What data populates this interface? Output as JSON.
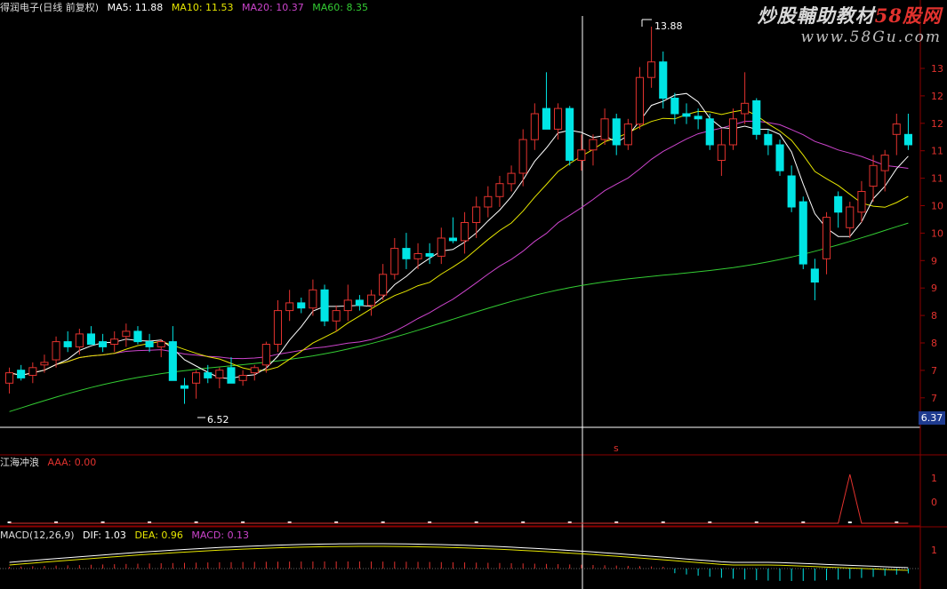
{
  "watermark": {
    "line1_main": "炒股輔助教材",
    "line1_accent": "58股网",
    "line2": "www.58Gu.com"
  },
  "main_panel": {
    "stock_title": "得润电子(日线 前复权)",
    "ma5": "MA5: 11.88",
    "ma10": "MA10: 11.53",
    "ma20": "MA20: 10.37",
    "ma60": "MA60: 8.35",
    "high_label": "13.88",
    "low_label": "6.52",
    "price_box": "6.37",
    "axis_ticks": [
      "13",
      "12",
      "12",
      "11",
      "11",
      "10",
      "10",
      "9",
      "9",
      "8",
      "8",
      "7",
      "7"
    ],
    "marker": "s"
  },
  "indicator_panel": {
    "name": "江海冲浪",
    "value": "AAA: 0.00",
    "axis_ticks": [
      "1",
      "0"
    ]
  },
  "macd_panel": {
    "name": "MACD(12,26,9)",
    "dif": "DIF: 1.03",
    "dea": "DEA: 0.96",
    "macd": "MACD: 0.13",
    "axis_ticks": [
      "1"
    ]
  },
  "colors": {
    "up": "#e2322e",
    "down": "#00e5e5",
    "ma5": "#ffffff",
    "ma10": "#e6e600",
    "ma20": "#cc44cc",
    "ma60": "#33cc33",
    "grid": "#8b0000"
  },
  "chart_data": {
    "type": "candlestick",
    "ohlc": [
      [
        7.0,
        7.3,
        6.8,
        7.2
      ],
      [
        7.25,
        7.35,
        7.05,
        7.1
      ],
      [
        7.15,
        7.4,
        7.0,
        7.3
      ],
      [
        7.35,
        7.55,
        7.2,
        7.4
      ],
      [
        7.45,
        7.9,
        7.3,
        7.8
      ],
      [
        7.8,
        8.0,
        7.6,
        7.7
      ],
      [
        7.7,
        8.05,
        7.55,
        7.95
      ],
      [
        7.95,
        8.1,
        7.8,
        7.75
      ],
      [
        7.8,
        7.95,
        7.6,
        7.7
      ],
      [
        7.75,
        8.0,
        7.6,
        7.85
      ],
      [
        7.9,
        8.15,
        7.7,
        8.0
      ],
      [
        8.0,
        8.1,
        7.75,
        7.8
      ],
      [
        7.8,
        7.95,
        7.6,
        7.7
      ],
      [
        7.7,
        7.85,
        7.5,
        7.8
      ],
      [
        7.8,
        8.1,
        7.2,
        7.05
      ],
      [
        6.95,
        7.1,
        6.6,
        6.9
      ],
      [
        7.0,
        7.25,
        6.7,
        7.2
      ],
      [
        7.2,
        7.35,
        7.0,
        7.1
      ],
      [
        7.1,
        7.3,
        6.9,
        7.25
      ],
      [
        7.3,
        7.5,
        7.1,
        7.0
      ],
      [
        7.05,
        7.25,
        6.95,
        7.15
      ],
      [
        7.2,
        7.35,
        7.05,
        7.3
      ],
      [
        7.35,
        7.8,
        7.2,
        7.75
      ],
      [
        7.75,
        8.6,
        7.6,
        8.4
      ],
      [
        8.4,
        8.8,
        8.2,
        8.55
      ],
      [
        8.55,
        8.65,
        8.35,
        8.45
      ],
      [
        8.45,
        9.0,
        8.3,
        8.8
      ],
      [
        8.8,
        8.9,
        8.1,
        8.2
      ],
      [
        8.2,
        8.5,
        8.0,
        8.4
      ],
      [
        8.4,
        8.9,
        8.2,
        8.6
      ],
      [
        8.6,
        8.7,
        8.4,
        8.5
      ],
      [
        8.5,
        8.8,
        8.3,
        8.7
      ],
      [
        8.7,
        9.3,
        8.6,
        9.1
      ],
      [
        9.1,
        9.8,
        9.0,
        9.6
      ],
      [
        9.6,
        9.9,
        9.2,
        9.4
      ],
      [
        9.4,
        9.7,
        9.2,
        9.5
      ],
      [
        9.5,
        9.7,
        9.3,
        9.45
      ],
      [
        9.45,
        10.0,
        9.3,
        9.8
      ],
      [
        9.8,
        10.2,
        9.7,
        9.75
      ],
      [
        9.75,
        10.3,
        9.5,
        10.1
      ],
      [
        10.1,
        10.6,
        9.8,
        10.4
      ],
      [
        10.4,
        10.8,
        10.2,
        10.6
      ],
      [
        10.6,
        11.0,
        10.4,
        10.85
      ],
      [
        10.85,
        11.2,
        10.7,
        11.05
      ],
      [
        11.05,
        11.9,
        10.8,
        11.7
      ],
      [
        11.7,
        12.4,
        11.5,
        12.2
      ],
      [
        12.3,
        13.0,
        12.1,
        11.9
      ],
      [
        11.9,
        12.4,
        11.7,
        12.3
      ],
      [
        12.3,
        12.35,
        11.2,
        11.3
      ],
      [
        11.3,
        11.8,
        11.1,
        11.5
      ],
      [
        11.5,
        11.8,
        11.2,
        11.7
      ],
      [
        11.7,
        12.3,
        11.6,
        12.1
      ],
      [
        12.1,
        12.2,
        11.4,
        11.6
      ],
      [
        11.6,
        12.1,
        11.5,
        12.0
      ],
      [
        12.0,
        13.1,
        11.9,
        12.9
      ],
      [
        12.9,
        13.88,
        12.7,
        13.2
      ],
      [
        13.2,
        13.4,
        12.3,
        12.5
      ],
      [
        12.5,
        12.6,
        12.0,
        12.2
      ],
      [
        12.2,
        12.4,
        12.0,
        12.15
      ],
      [
        12.15,
        12.3,
        11.9,
        12.1
      ],
      [
        12.1,
        12.2,
        11.5,
        11.6
      ],
      [
        11.3,
        11.9,
        11.0,
        11.6
      ],
      [
        11.6,
        12.3,
        11.5,
        12.1
      ],
      [
        12.2,
        13.0,
        12.0,
        12.4
      ],
      [
        12.45,
        12.5,
        11.7,
        11.8
      ],
      [
        11.8,
        11.9,
        11.4,
        11.6
      ],
      [
        11.6,
        11.7,
        11.0,
        11.1
      ],
      [
        11.0,
        11.2,
        10.3,
        10.4
      ],
      [
        10.5,
        10.6,
        9.2,
        9.3
      ],
      [
        9.2,
        9.4,
        8.6,
        8.95
      ],
      [
        9.4,
        10.3,
        9.1,
        10.2
      ],
      [
        10.6,
        10.7,
        10.0,
        10.3
      ],
      [
        10.0,
        10.5,
        9.8,
        10.4
      ],
      [
        10.3,
        10.9,
        10.1,
        10.7
      ],
      [
        10.8,
        11.4,
        10.5,
        11.2
      ],
      [
        11.1,
        11.5,
        10.7,
        11.4
      ],
      [
        11.8,
        12.2,
        11.4,
        12.0
      ],
      [
        11.8,
        12.2,
        11.5,
        11.6
      ]
    ],
    "high": 13.88,
    "low": 6.52,
    "ylim": [
      6.37,
      13.88
    ]
  }
}
